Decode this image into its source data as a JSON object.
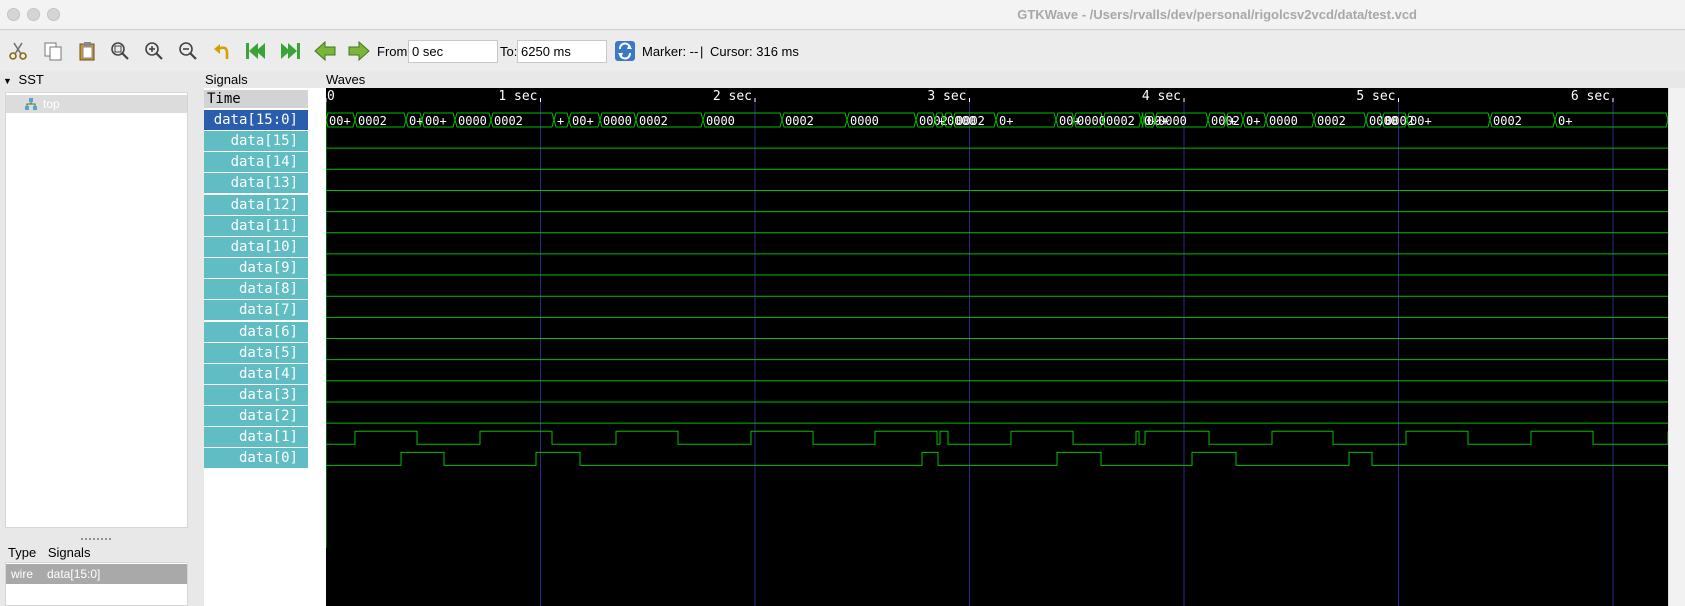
{
  "window": {
    "title": "GTKWave - /Users/rvalls/dev/personal/rigolcsv2vcd/data/test.vcd"
  },
  "toolbar": {
    "from_label": "From:",
    "from_value": "0 sec",
    "to_label": "To:",
    "to_value": "6250 ms",
    "marker_text": "Marker: --",
    "separator": "|",
    "cursor_text": "Cursor: 316 ms"
  },
  "sst": {
    "header": "SST",
    "tree": [
      {
        "label": "top"
      }
    ]
  },
  "type_panel": {
    "type_header": "Type",
    "signals_header": "Signals",
    "rows": [
      {
        "type": "wire",
        "signal": "data[15:0]"
      }
    ]
  },
  "signals_panel": {
    "header": "Signals",
    "time_label": "Time",
    "items": [
      "data[15:0]",
      "data[15]",
      "data[14]",
      "data[13]",
      "data[12]",
      "data[11]",
      "data[10]",
      "data[9]",
      "data[8]",
      "data[7]",
      "data[6]",
      "data[5]",
      "data[4]",
      "data[3]",
      "data[2]",
      "data[1]",
      "data[0]"
    ]
  },
  "waves_panel": {
    "header": "Waves",
    "time_ticks": [
      "0",
      "1 sec",
      "2 sec",
      "3 sec",
      "4 sec",
      "5 sec",
      "6 sec"
    ],
    "bus_values": [
      "00+",
      "0002",
      "0+",
      "00+",
      "0000",
      "0002",
      "+",
      "00+",
      "0000",
      "0002",
      "0000",
      "0002",
      "0000",
      "0002",
      "+",
      "0000",
      "0002",
      "0+",
      "00+",
      "0000",
      "0002",
      "0+",
      "00+",
      "0000",
      "0002",
      "+",
      "0+",
      "0000",
      "0002",
      "0000",
      "0002"
    ]
  },
  "colors": {
    "signal_bg": "#5fbdc3",
    "signal_selected": "#2a5dac",
    "wave_green": "#00c000",
    "grid_blue": "#2a2a8a",
    "waves_bg": "#000000"
  }
}
